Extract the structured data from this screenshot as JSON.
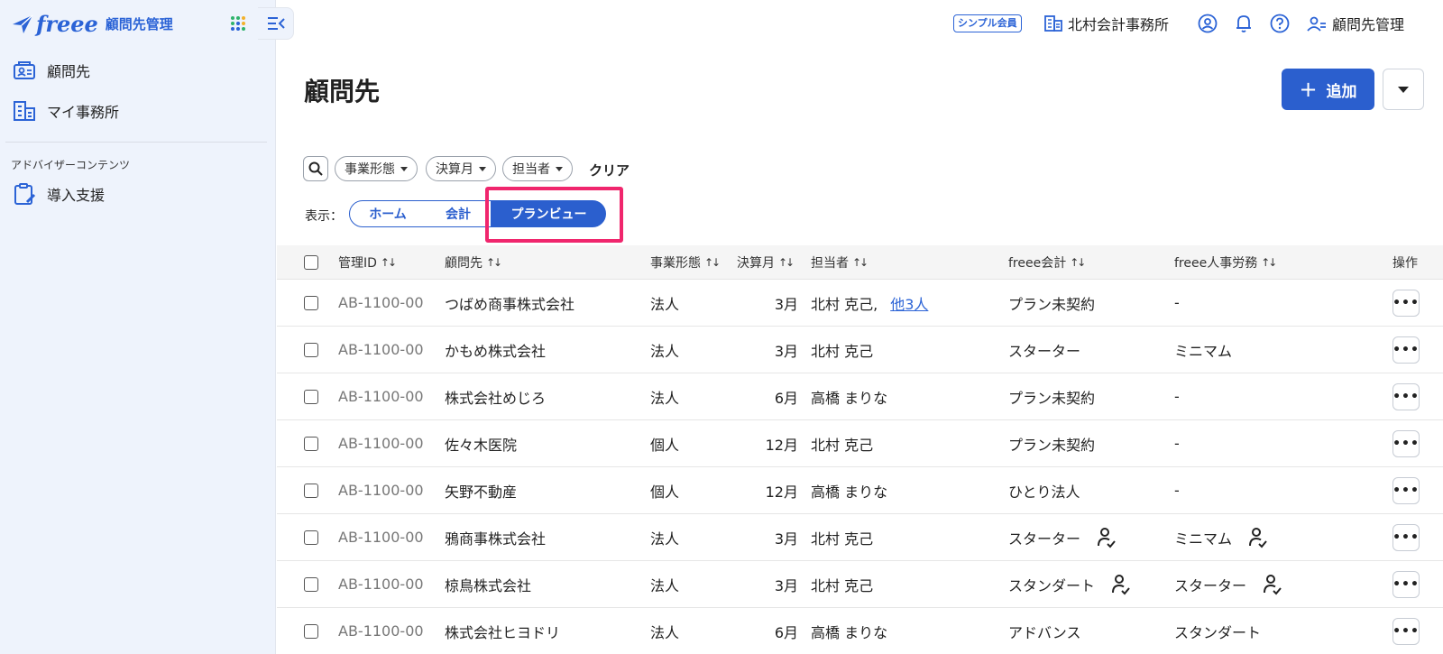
{
  "sidebar": {
    "logo_text": "freee",
    "app_name": "顧問先管理",
    "items": [
      {
        "label": "顧問先",
        "icon": "client-card-icon"
      },
      {
        "label": "マイ事務所",
        "icon": "building-icon"
      }
    ],
    "section_label": "アドバイザーコンテンツ",
    "section_items": [
      {
        "label": "導入支援",
        "icon": "clipboard-edit-icon"
      }
    ]
  },
  "header": {
    "plan_badge": "シンプル会員",
    "office_name": "北村会計事務所",
    "user_menu_label": "顧問先管理",
    "icons": [
      "account-circle-icon",
      "bell-icon",
      "help-icon",
      "user-switch-icon"
    ]
  },
  "page": {
    "title": "顧問先",
    "add_button": "追加"
  },
  "filters": {
    "chips": [
      "事業形態",
      "決算月",
      "担当者"
    ],
    "clear": "クリア",
    "view_label": "表示：",
    "views": [
      "ホーム",
      "会計",
      "プランビュー"
    ],
    "active_view": "プランビュー"
  },
  "table": {
    "headers": {
      "id": "管理ID",
      "name": "顧問先",
      "type": "事業形態",
      "month": "決算月",
      "owner": "担当者",
      "accounting": "freee会計",
      "hr": "freee人事労務",
      "ops": "操作"
    },
    "rows": [
      {
        "id": "AB-1100-00",
        "name": "つばめ商事株式会社",
        "type": "法人",
        "month": "3月",
        "owner": "北村 克己,",
        "owner_extra": "他3人",
        "accounting": "プラン未契約",
        "hr": "-"
      },
      {
        "id": "AB-1100-00",
        "name": "かもめ株式会社",
        "type": "法人",
        "month": "3月",
        "owner": "北村 克己",
        "accounting": "スターター",
        "hr": "ミニマム"
      },
      {
        "id": "AB-1100-00",
        "name": "株式会社めじろ",
        "type": "法人",
        "month": "6月",
        "owner": "高橋 まりな",
        "accounting": "プラン未契約",
        "hr": "-"
      },
      {
        "id": "AB-1100-00",
        "name": "佐々木医院",
        "type": "個人",
        "month": "12月",
        "owner": "北村 克己",
        "accounting": "プラン未契約",
        "hr": "-"
      },
      {
        "id": "AB-1100-00",
        "name": "矢野不動産",
        "type": "個人",
        "month": "12月",
        "owner": "高橋 まりな",
        "accounting": "ひとり法人",
        "hr": "-"
      },
      {
        "id": "AB-1100-00",
        "name": "鴉商事株式会社",
        "type": "法人",
        "month": "3月",
        "owner": "北村 克己",
        "accounting": "スターター",
        "hr": "ミニマム",
        "acc_person_ok": true,
        "hr_person_ok": true
      },
      {
        "id": "AB-1100-00",
        "name": "椋鳥株式会社",
        "type": "法人",
        "month": "3月",
        "owner": "北村 克己",
        "accounting": "スタンダート",
        "hr": "スターター",
        "acc_person_ok": true,
        "hr_person_ok": true
      },
      {
        "id": "AB-1100-00",
        "name": "株式会社ヒヨドリ",
        "type": "法人",
        "month": "6月",
        "owner": "高橋 まりな",
        "accounting": "アドバンス",
        "hr": "スタンダート"
      }
    ]
  },
  "colors": {
    "primary": "#2b5fce",
    "sidebar_bg": "#eef3fc",
    "highlight": "#f0266d"
  }
}
